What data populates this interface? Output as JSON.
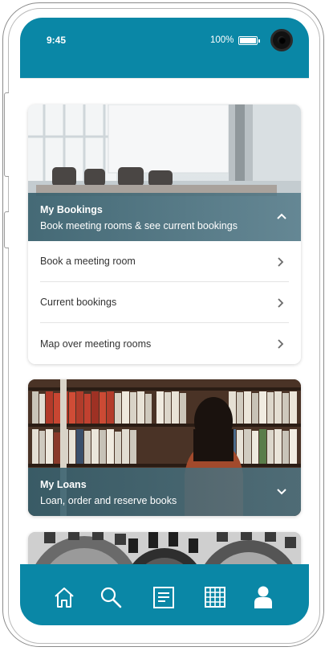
{
  "status_bar": {
    "time": "9:45",
    "battery": "100%"
  },
  "cards": [
    {
      "title": "My Bookings",
      "subtitle": "Book meeting rooms & see current bookings",
      "expanded": true,
      "items": [
        {
          "label": "Book a meeting room"
        },
        {
          "label": "Current bookings"
        },
        {
          "label": "Map over meeting rooms"
        }
      ]
    },
    {
      "title": "My Loans",
      "subtitle": "Loan, order and reserve books",
      "expanded": false
    }
  ],
  "bottom_nav": [
    {
      "icon": "home-icon"
    },
    {
      "icon": "search-icon"
    },
    {
      "icon": "document-icon"
    },
    {
      "icon": "grid-icon"
    },
    {
      "icon": "user-icon"
    }
  ],
  "colors": {
    "brand": "#0a87a6",
    "overlay": "#4a7d8c",
    "background": "#ffffff"
  }
}
